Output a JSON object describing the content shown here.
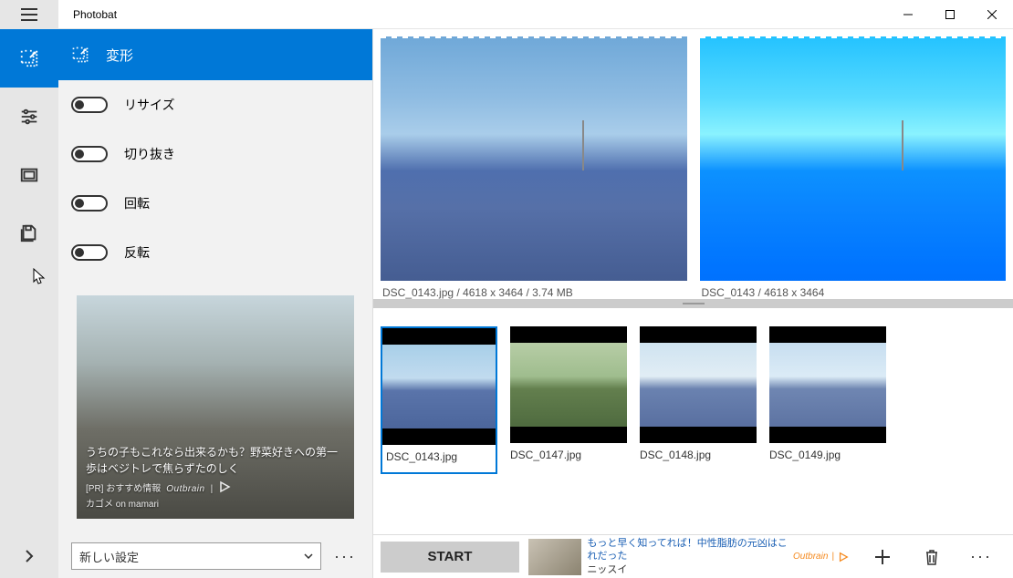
{
  "title": "Photobat",
  "sidebar": {
    "tools": [
      "transform",
      "adjust",
      "frame",
      "save"
    ]
  },
  "options": {
    "header_label": "変形",
    "items": [
      {
        "label": "リサイズ"
      },
      {
        "label": "切り抜き"
      },
      {
        "label": "回転"
      },
      {
        "label": "反転"
      }
    ]
  },
  "ad1": {
    "headline": "うちの子もこれなら出来るかも？野菜好きへの第一歩はベジトレで焦らずたのしく",
    "pr": "[PR] おすすめ情報",
    "brand": "Outbrain",
    "sub": "カゴメ on mamari"
  },
  "settings_select": {
    "label": "新しい設定"
  },
  "previews": {
    "left_caption": "DSC_0143.jpg / 4618 x 3464 / 3.74 MB",
    "right_caption": "DSC_0143 / 4618 x 3464"
  },
  "thumbs": [
    {
      "label": "DSC_0143.jpg",
      "selected": true
    },
    {
      "label": "DSC_0147.jpg",
      "selected": false
    },
    {
      "label": "DSC_0148.jpg",
      "selected": false
    },
    {
      "label": "DSC_0149.jpg",
      "selected": false
    }
  ],
  "footer": {
    "start_label": "START",
    "ad2_line1": "もっと早く知ってれば！中性脂肪の元凶はこれだった",
    "ad2_line2": "ニッスイ",
    "ad2_brand": "Outbrain"
  }
}
